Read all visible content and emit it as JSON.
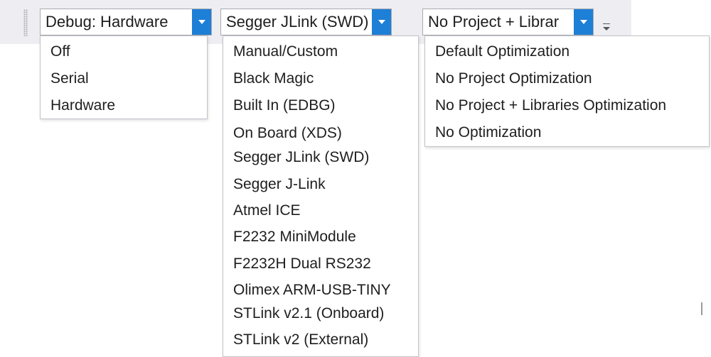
{
  "toolbar": {
    "debug_combo": {
      "value": "Debug: Hardware"
    },
    "programmer_combo": {
      "value": "Segger JLink (SWD)"
    },
    "optimization_combo": {
      "value": "No Project + Librar"
    }
  },
  "debug_menu": {
    "items": [
      "Off",
      "Serial",
      "Hardware"
    ]
  },
  "programmer_menu": {
    "items": [
      "Manual/Custom",
      "Black Magic",
      "Built In (EDBG)",
      "On Board (XDS)",
      "Segger JLink (SWD)",
      "Segger J-Link",
      "Atmel ICE",
      "F2232 MiniModule",
      "F2232H Dual RS232",
      "Olimex ARM-USB-TINY",
      "STLink v2.1 (Onboard)",
      "STLink v2 (External)"
    ]
  },
  "optimization_menu": {
    "items": [
      "Default Optimization",
      "No Project  Optimization",
      "No Project + Libraries Optimization",
      "No Optimization"
    ]
  },
  "colors": {
    "accent": "#1e7fd6",
    "toolbar_bg": "#eeeef2",
    "text": "#1e1e1e"
  }
}
